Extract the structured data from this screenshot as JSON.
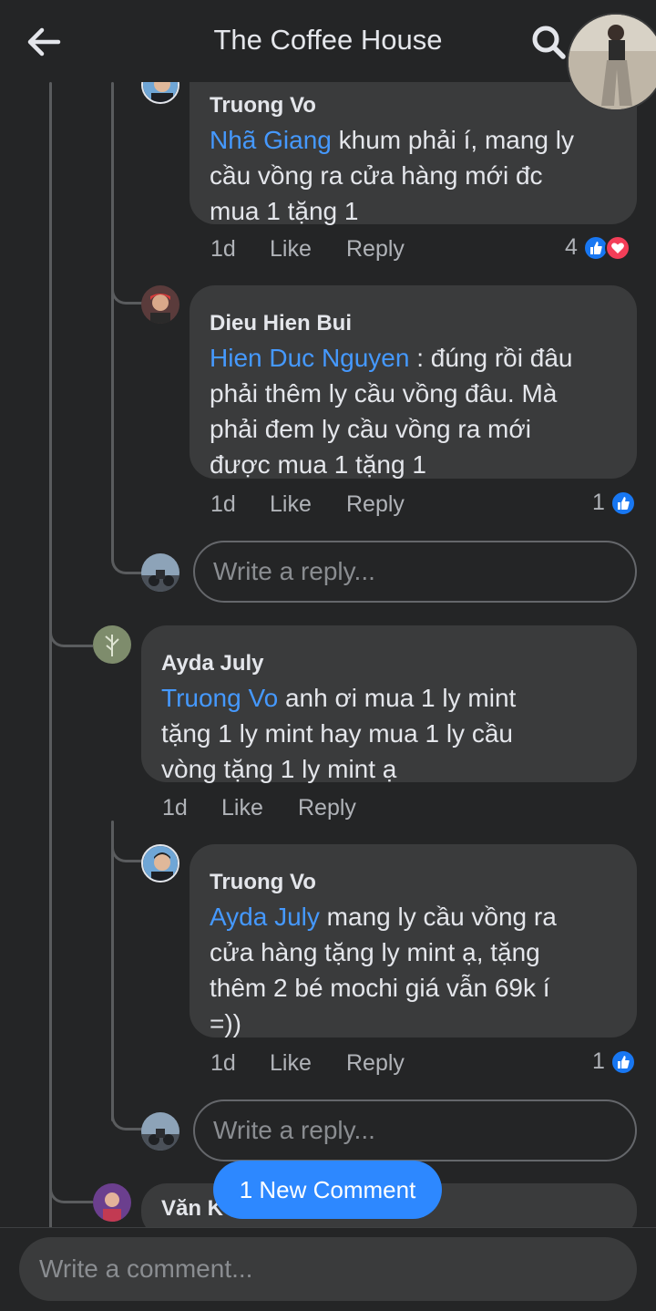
{
  "header": {
    "title": "The Coffee House"
  },
  "comments": [
    {
      "author": "Truong Vo",
      "mention": "Nhã Giang",
      "text_l1": " khum phải í, mang ly",
      "text_l2": "cầu vồng ra cửa hàng mới đc",
      "text_l3": "mua 1 tặng 1",
      "time": "1d",
      "like": "Like",
      "reply": "Reply",
      "reactions": "4"
    },
    {
      "author": "Dieu Hien Bui",
      "mention": "Hien Duc Nguyen",
      "text_l1": " : đúng rồi đâu",
      "text_l2": "phải thêm ly cầu vồng đâu. Mà",
      "text_l3": "phải đem ly cầu vồng ra mới",
      "text_l4": "được mua 1 tặng 1",
      "time": "1d",
      "like": "Like",
      "reply": "Reply",
      "reactions": "1"
    },
    {
      "author": "Ayda July",
      "mention": "Truong Vo",
      "text_l1": " anh ơi mua 1 ly mint",
      "text_l2": "tặng 1 ly mint hay mua 1 ly cầu",
      "text_l3": "vòng tặng 1 ly mint ạ",
      "time": "1d",
      "like": "Like",
      "reply": "Reply"
    },
    {
      "author": "Truong Vo",
      "mention": "Ayda July",
      "text_l1": " mang ly cầu vồng ra",
      "text_l2": "cửa hàng tặng ly mint ạ, tặng",
      "text_l3": "thêm 2 bé mochi giá vẫn 69k í",
      "text_l4": "=))",
      "time": "1d",
      "like": "Like",
      "reply": "Reply",
      "reactions": "1"
    },
    {
      "author": "Văn K"
    }
  ],
  "reply_placeholder": "Write a reply...",
  "new_comment_label": "1 New Comment",
  "comment_placeholder": "Write a comment..."
}
